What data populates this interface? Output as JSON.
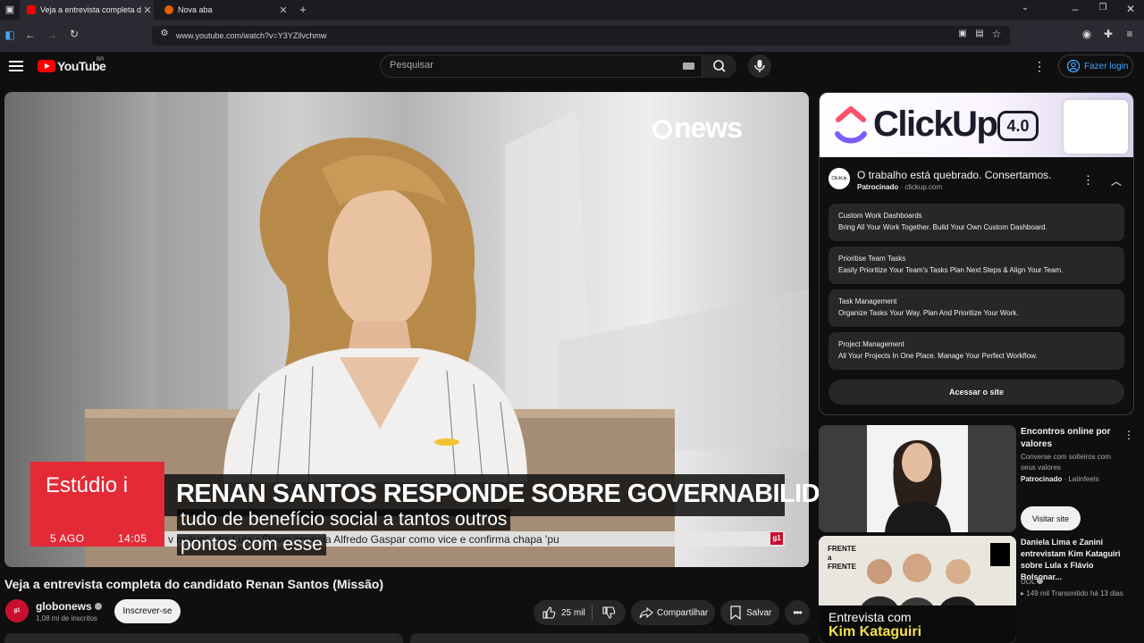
{
  "browser": {
    "tabs": [
      {
        "title": "Veja a entrevista completa do c",
        "active": true
      },
      {
        "title": "Nova aba",
        "active": false
      }
    ],
    "url": "www.youtube.com/watch?v=Y3YZllvchmw"
  },
  "header": {
    "logo": "YouTube",
    "country": "BR",
    "search_placeholder": "Pesquisar",
    "login_label": "Fazer login"
  },
  "video": {
    "brand_logo": "news",
    "lower_third": {
      "show": "Estúdio i",
      "date": "5 AGO",
      "time": "14:05",
      "headline": "RENAN SANTOS RESPONDE SOBRE GOVERNABILIDADE",
      "ticker": "v                   nsável', diz Lula  •  Flávio anuncia Alfredo Gaspar como vice e confirma chapa 'pu"
    },
    "captions": [
      "tudo de benefício social a tantos outros",
      "pontos com esse"
    ]
  },
  "watch": {
    "title": "Veja a entrevista completa do candidato Renan Santos (Missão)",
    "channel": "globonews",
    "subscribers": "1,08 mi de inscritos",
    "subscribe_label": "Inscrever-se",
    "likes": "25 mil",
    "share_label": "Compartilhar",
    "save_label": "Salvar"
  },
  "ad": {
    "brand": "ClickUp",
    "version": "4.0",
    "headline": "O trabalho está quebrado. Consertamos.",
    "sponsored": "Patrocinado",
    "domain": "clickup.com",
    "items": [
      {
        "title": "Custom Work Dashboards",
        "desc": "Bring All Your Work Together. Build Your Own Custom Dashboard."
      },
      {
        "title": "Prioritise Team Tasks",
        "desc": "Easily Prioritize Your Team's Tasks Plan Next Steps & Align Your Team."
      },
      {
        "title": "Task Management",
        "desc": "Organize Tasks Your Way. Plan And Prioritize Your Work."
      },
      {
        "title": "Project Management",
        "desc": "All Your Projects In One Place. Manage Your Perfect Workflow."
      }
    ],
    "cta": "Acessar o site"
  },
  "sidebar": {
    "rec1": {
      "title": "Encontros online por valores",
      "desc": "Converse com solteiros com seus valores",
      "sponsored": "Patrocinado",
      "advertiser": "Latinfeels",
      "cta": "Visitar site"
    },
    "rec2": {
      "thumb_top": "FRENTE a FRENTE",
      "thumb_caption": "Entrevista com",
      "thumb_name": "Kim Kataguiri",
      "title": "Daniela Lima e Zanini entrevistam Kim Kataguiri sobre Lula x Flávio Bolsonar...",
      "channel": "UOL",
      "meta": "149 mil  Transmitido há 13 dias"
    }
  },
  "colors": {
    "accent": "#3ea6ff",
    "youtube_red": "#ff0000",
    "globo_red": "#e32a36"
  }
}
